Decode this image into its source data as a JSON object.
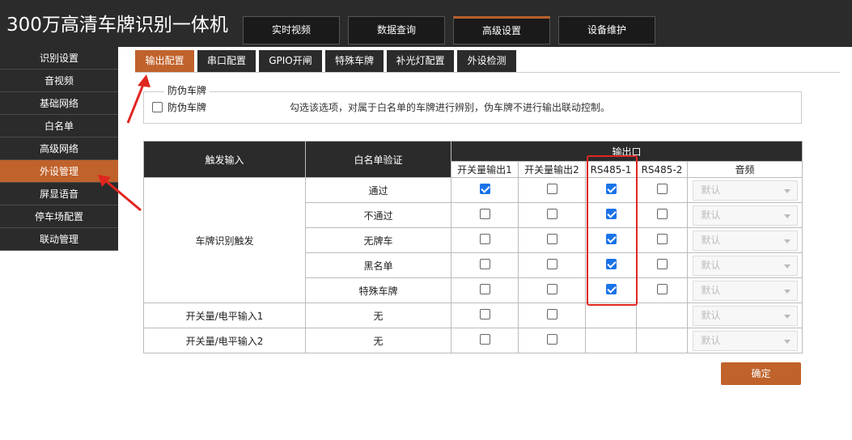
{
  "app": {
    "title": "300万高清车牌识别一体机"
  },
  "top_nav": [
    {
      "label": "实时视频",
      "active": false
    },
    {
      "label": "数据查询",
      "active": false
    },
    {
      "label": "高级设置",
      "active": true
    },
    {
      "label": "设备维护",
      "active": false
    }
  ],
  "sidebar": [
    {
      "label": "识别设置",
      "active": false
    },
    {
      "label": "音视频",
      "active": false
    },
    {
      "label": "基础网络",
      "active": false
    },
    {
      "label": "白名单",
      "active": false
    },
    {
      "label": "高级网络",
      "active": false
    },
    {
      "label": "外设管理",
      "active": true
    },
    {
      "label": "屏显语音",
      "active": false
    },
    {
      "label": "停车场配置",
      "active": false
    },
    {
      "label": "联动管理",
      "active": false
    }
  ],
  "sub_tabs": [
    {
      "label": "输出配置",
      "active": true
    },
    {
      "label": "串口配置",
      "active": false
    },
    {
      "label": "GPIO开闸",
      "active": false
    },
    {
      "label": "特殊车牌",
      "active": false
    },
    {
      "label": "补光灯配置",
      "active": false
    },
    {
      "label": "外设检测",
      "active": false
    }
  ],
  "anti_fake": {
    "legend": "防伪车牌",
    "checkbox_label": "防伪车牌",
    "checked": false,
    "hint": "勾选该选项，对属于白名单的车牌进行辨别，伪车牌不进行输出联动控制。"
  },
  "table": {
    "header_trigger": "触发输入",
    "header_whitelist": "白名单验证",
    "header_output": "输出口",
    "output_cols": [
      "开关量输出1",
      "开关量输出2",
      "RS485-1",
      "RS485-2",
      "音频"
    ],
    "plate_trigger_label": "车牌识别触发",
    "plate_rows": [
      {
        "verify": "通过",
        "out1": true,
        "out2": false,
        "rs1": true,
        "rs2": false,
        "audio": "默认"
      },
      {
        "verify": "不通过",
        "out1": false,
        "out2": false,
        "rs1": true,
        "rs2": false,
        "audio": "默认"
      },
      {
        "verify": "无牌车",
        "out1": false,
        "out2": false,
        "rs1": true,
        "rs2": false,
        "audio": "默认"
      },
      {
        "verify": "黑名单",
        "out1": false,
        "out2": false,
        "rs1": true,
        "rs2": false,
        "audio": "默认"
      },
      {
        "verify": "特殊车牌",
        "out1": false,
        "out2": false,
        "rs1": true,
        "rs2": false,
        "audio": "默认"
      }
    ],
    "io_rows": [
      {
        "trigger": "开关量/电平输入1",
        "verify": "无",
        "out1": false,
        "out2": false,
        "audio": "默认"
      },
      {
        "trigger": "开关量/电平输入2",
        "verify": "无",
        "out1": false,
        "out2": false,
        "audio": "默认"
      }
    ]
  },
  "confirm_label": "确定",
  "colors": {
    "accent": "#c0622b",
    "dark": "#2b2b2b",
    "annotation_red": "#e0261f",
    "check_blue": "#1a73e8"
  }
}
